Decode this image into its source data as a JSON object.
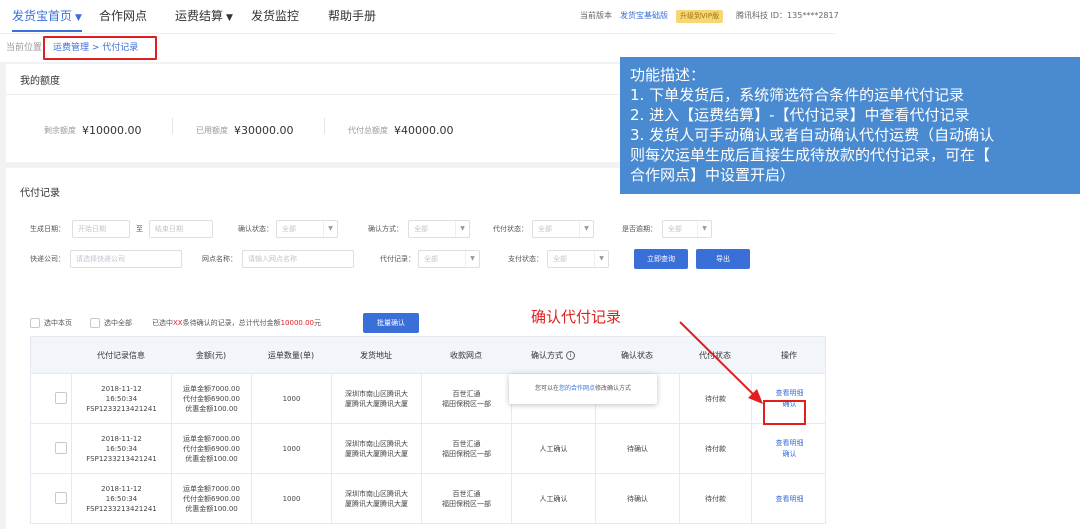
{
  "nav": {
    "items": [
      {
        "label": "发货宝首页",
        "active": true,
        "has_dropdown": true
      },
      {
        "label": "合作网点",
        "active": false,
        "has_dropdown": false
      },
      {
        "label": "运费结算",
        "active": false,
        "has_dropdown": true
      },
      {
        "label": "发货监控",
        "active": false,
        "has_dropdown": false
      },
      {
        "label": "帮助手册",
        "active": false,
        "has_dropdown": false
      }
    ],
    "version_label": "当前版本",
    "version_value": "发货宝基础版",
    "upgrade_badge": "升级到VIP版",
    "account": "腾讯科技 ID：135****2817"
  },
  "breadcrumb": {
    "prefix": "当前位置",
    "path": "运费管理 > 代付记录"
  },
  "quota": {
    "title": "我的额度",
    "items": [
      {
        "label": "剩余额度",
        "value": "¥10000.00"
      },
      {
        "label": "已用额度",
        "value": "¥30000.00"
      },
      {
        "label": "代付总额度",
        "value": "¥40000.00"
      }
    ]
  },
  "records": {
    "title": "代付记录",
    "filters": {
      "gen_date_label": "生成日期：",
      "start_placeholder": "开始日期",
      "to": "至",
      "end_placeholder": "结束日期",
      "confirm_status_label": "确认状态：",
      "confirm_method_label": "确认方式：",
      "pay_status_label": "代付状态：",
      "overdue_label": "是否逾期：",
      "all": "全部",
      "courier_label": "快递公司：",
      "courier_placeholder": "请选择快递公司",
      "outlet_label": "网点名称：",
      "outlet_placeholder": "请输入网点名称",
      "pay_record_label": "代付记录：",
      "pay_record_value": "全部",
      "payment_status_label": "支付状态：",
      "search_button": "立即查询",
      "export_button": "导出"
    },
    "selection": {
      "select_page": "选中本页",
      "select_all": "选中全部",
      "summary_prefix": "已选中",
      "summary_count": "XX",
      "summary_mid": "条待确认的记录，总计代付金额",
      "summary_amount": "10000.00",
      "summary_suffix": "元",
      "batch_button": "批量确认"
    },
    "table": {
      "headers": [
        "代付记录信息",
        "金额(元)",
        "运单数量(单)",
        "发货地址",
        "收款网点",
        "确认方式",
        "确认状态",
        "代付状态",
        "操作"
      ],
      "rows": [
        {
          "info": "2018-11-12\n16:50:34\nFSP1233213421241",
          "amount": "运单金额7000.00\n代付金额6900.00\n优惠金额100.00",
          "count": "1000",
          "address": "深圳市南山区腾讯大\n厦腾讯大厦腾讯大厦",
          "outlet": "百世汇通\n福田保税区一部",
          "method": "",
          "status": "",
          "pay_status": "待付款",
          "action_view": "查看明细",
          "action_confirm": "确认"
        },
        {
          "info": "2018-11-12\n16:50:34\nFSP1233213421241",
          "amount": "运单金额7000.00\n代付金额6900.00\n优惠金额100.00",
          "count": "1000",
          "address": "深圳市南山区腾讯大\n厦腾讯大厦腾讯大厦",
          "outlet": "百世汇通\n福田保税区一部",
          "method": "人工确认",
          "status": "待确认",
          "pay_status": "待付款",
          "action_view": "查看明细",
          "action_confirm": "确认"
        },
        {
          "info": "2018-11-12\n16:50:34\nFSP1233213421241",
          "amount": "运单金额7000.00\n代付金额6900.00\n优惠金额100.00",
          "count": "1000",
          "address": "深圳市南山区腾讯大\n厦腾讯大厦腾讯大厦",
          "outlet": "百世汇通\n福田保税区一部",
          "method": "人工确认",
          "status": "待确认",
          "pay_status": "待付款",
          "action_view": "查看明细",
          "action_confirm": ""
        }
      ]
    },
    "tooltip": {
      "prefix": "您可以在",
      "link": "您的合作网点",
      "suffix": "修改确认方式"
    }
  },
  "annotation": {
    "panel_title": "功能描述：",
    "panel_lines": [
      "1. 下单发货后，系统筛选符合条件的运单代付记录",
      "2. 进入【运费结算】-【代付记录】中查看代付记录",
      "3. 发货人可手动确认或者自动确认代付运费（自动确认",
      "则每次运单生成后直接生成待放款的代付记录，可在【",
      "合作网点】中设置开启）"
    ],
    "callout": "确认代付记录"
  },
  "colors": {
    "accent": "#3a6fd8",
    "annotation_red": "#e02020",
    "panel_bg": "#4a8ad0",
    "badge_bg": "#f7d774"
  }
}
